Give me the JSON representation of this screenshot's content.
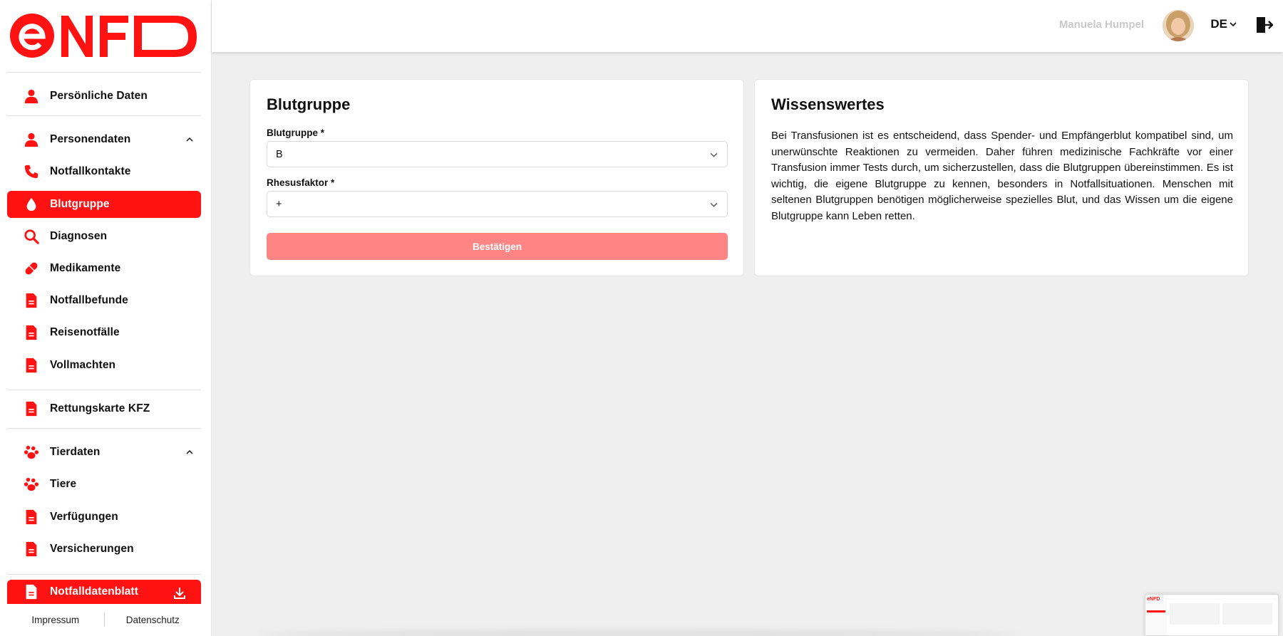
{
  "brand": {
    "logo_text": "eNFD",
    "accent": "#ff1212"
  },
  "sidebar": {
    "items": [
      {
        "label": "Persönliche Daten",
        "icon": "person-icon"
      },
      {
        "label": "Personendaten",
        "icon": "person-icon",
        "expanded": true
      },
      {
        "label": "Notfallkontakte",
        "icon": "phone-icon"
      },
      {
        "label": "Blutgruppe",
        "icon": "drop-icon",
        "active": true
      },
      {
        "label": "Diagnosen",
        "icon": "search-icon"
      },
      {
        "label": "Medikamente",
        "icon": "pill-icon"
      },
      {
        "label": "Notfallbefunde",
        "icon": "document-icon"
      },
      {
        "label": "Reisenotfälle",
        "icon": "document-icon"
      },
      {
        "label": "Vollmachten",
        "icon": "document-icon"
      },
      {
        "label": "Rettungskarte KFZ",
        "icon": "document-icon"
      },
      {
        "label": "Tierdaten",
        "icon": "paw-icon",
        "expanded": true
      },
      {
        "label": "Tiere",
        "icon": "paw-icon"
      },
      {
        "label": "Verfügungen",
        "icon": "document-icon"
      },
      {
        "label": "Versicherungen",
        "icon": "document-icon"
      },
      {
        "label": "Notfalldatenblatt",
        "icon": "document-icon",
        "highlighted": true
      }
    ],
    "footer": {
      "impressum": "Impressum",
      "datenschutz": "Datenschutz"
    }
  },
  "header": {
    "user_name": "Manuela Humpel",
    "language": "DE"
  },
  "blood_card": {
    "title": "Blutgruppe",
    "blood_group_label": "Blutgruppe *",
    "blood_group_value": "B",
    "rhesus_label": "Rhesusfaktor *",
    "rhesus_value": "+",
    "confirm_label": "Bestätigen"
  },
  "info_card": {
    "title": "Wissenswertes",
    "text": "Bei Transfusionen ist es entscheidend, dass Spender- und Empfängerblut kompatibel sind, um unerwünschte Reaktionen zu vermeiden. Daher führen medizinische Fachkräfte vor einer Transfusion immer Tests durch, um sicherzustellen, dass die Blutgruppen übereinstimmen. Es ist wichtig, die eigene Blutgruppe zu kennen, besonders in Notfallsituationen. Menschen mit seltenen Blutgruppen benötigen möglicherweise spezielles Blut, und das Wissen um die eigene Blutgruppe kann Leben retten."
  }
}
